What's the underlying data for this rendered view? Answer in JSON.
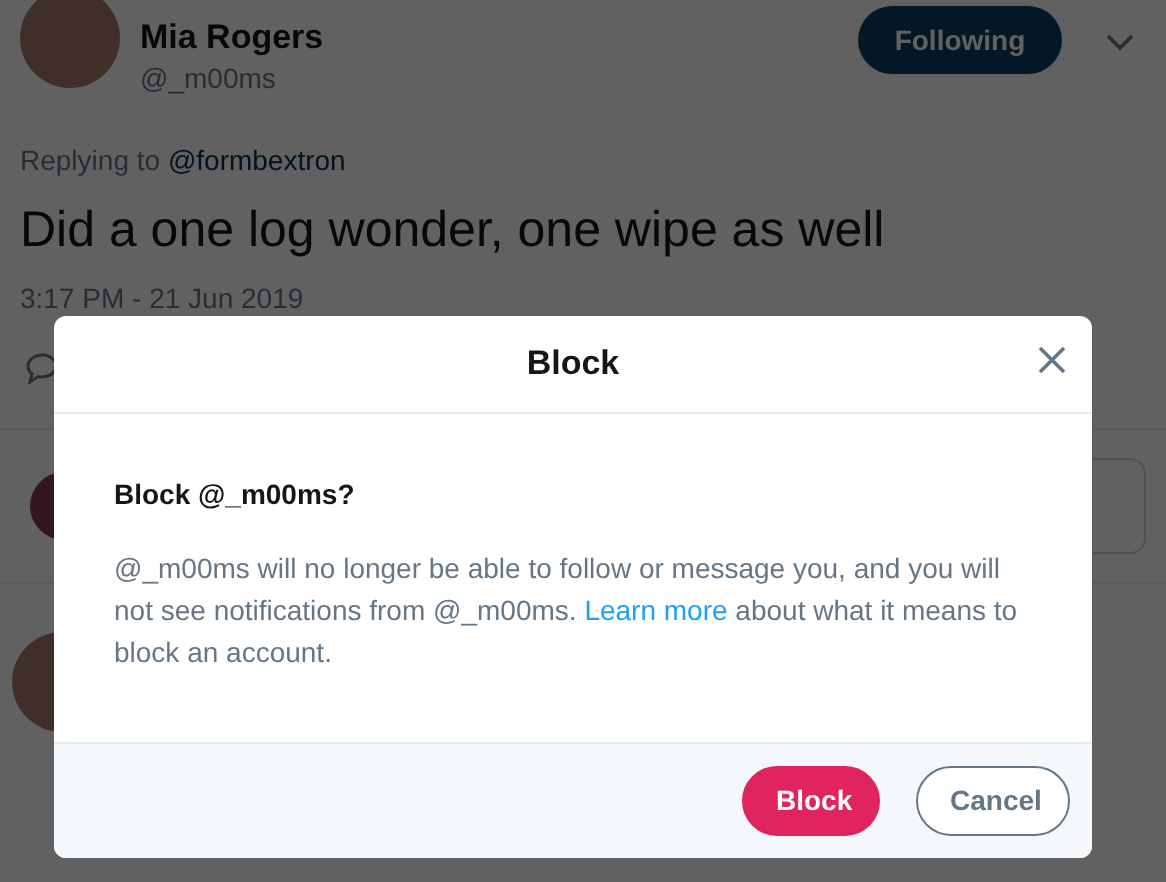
{
  "tweet": {
    "author": "Mia Rogers",
    "handle": "@_m00ms",
    "follow_button": "Following",
    "replying_label": "Replying to",
    "replying_to": "@formbextron",
    "text": "Did a one log wonder, one wipe as well",
    "timestamp": "3:17 PM - 21 Jun 2019"
  },
  "dialog": {
    "title": "Block",
    "heading": "Block @_m00ms?",
    "message_before": "@_m00ms will no longer be able to follow or message you, and you will not see notifications from @_m00ms.",
    "link": "Learn more",
    "message_after": "about what it means to block an account.",
    "buttons": [
      {
        "label": "Block",
        "kind": "danger"
      },
      {
        "label": "Cancel",
        "kind": "outline"
      }
    ]
  }
}
